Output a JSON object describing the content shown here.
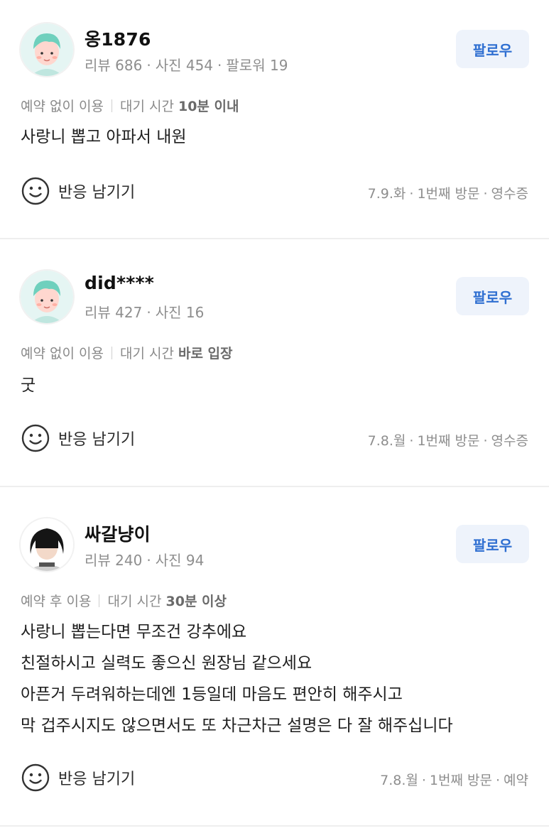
{
  "reviews": [
    {
      "avatar": "green-hair-character",
      "name": "옹1876",
      "stats": [
        "리뷰 686",
        "사진 454",
        "팔로워 19"
      ],
      "follow_label": "팔로우",
      "reservation": "예약 없이 이용",
      "wait_prefix": "대기 시간",
      "wait_value": "10분 이내",
      "body": [
        "사랑니 뽑고 아파서 내원"
      ],
      "react_label": "반응 남기기",
      "visit": [
        "7.9.화",
        "1번째 방문",
        "영수증"
      ]
    },
    {
      "avatar": "green-hair-character",
      "name": "did****",
      "stats": [
        "리뷰 427",
        "사진 16"
      ],
      "follow_label": "팔로우",
      "reservation": "예약 없이 이용",
      "wait_prefix": "대기 시간",
      "wait_value": "바로 입장",
      "body": [
        "굿"
      ],
      "react_label": "반응 남기기",
      "visit": [
        "7.8.월",
        "1번째 방문",
        "영수증"
      ]
    },
    {
      "avatar": "black-hair-character",
      "name": "싸갈냥이",
      "stats": [
        "리뷰 240",
        "사진 94"
      ],
      "follow_label": "팔로우",
      "reservation": "예약 후 이용",
      "wait_prefix": "대기 시간",
      "wait_value": "30분 이상",
      "body": [
        "사랑니 뽑는다면 무조건 강추에요",
        "친절하시고 실력도 좋으신 원장님 같으세요",
        "아픈거 두려워하는데엔 1등일데 마음도 편안히 해주시고",
        "막 겁주시지도 않으면서도 또 차근차근 설명은 다 잘 해주십니다"
      ],
      "react_label": "반응 남기기",
      "visit": [
        "7.8.월",
        "1번째 방문",
        "예약"
      ]
    }
  ],
  "colors": {
    "accent": "#2f6fd1",
    "follow_bg": "#eef3fb",
    "muted_text": "#8e8e8e",
    "divider": "#eeeeee"
  }
}
